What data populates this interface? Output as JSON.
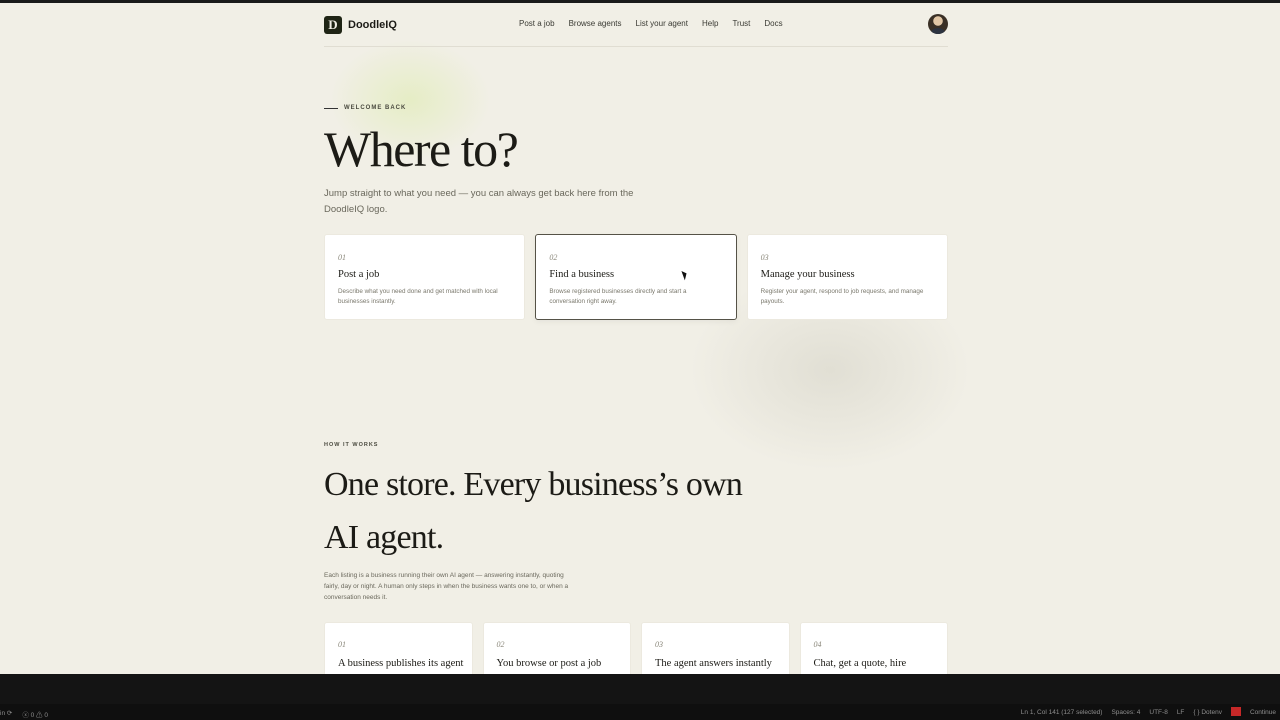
{
  "brand": {
    "mark": "D",
    "name": "DoodleIQ"
  },
  "nav": [
    "Post a job",
    "Browse agents",
    "List your agent",
    "Help",
    "Trust",
    "Docs"
  ],
  "hero": {
    "eyebrow": "WELCOME BACK",
    "title": "Where to?",
    "subtitle": "Jump straight to what you need — you can always get back here from the DoodleIQ logo."
  },
  "cards": [
    {
      "num": "01",
      "title": "Post a job",
      "desc": "Describe what you need done and get matched with local businesses instantly."
    },
    {
      "num": "02",
      "title": "Find a business",
      "desc": "Browse registered businesses directly and start a conversation right away."
    },
    {
      "num": "03",
      "title": "Manage your business",
      "desc": "Register your agent, respond to job requests, and manage payouts."
    }
  ],
  "how": {
    "eyebrow": "HOW IT WORKS",
    "title": "One store. Every business’s own AI agent.",
    "desc": "Each listing is a business running their own AI agent — answering instantly, quoting fairly, day or night. A human only steps in when the business wants one to, or when a conversation needs it."
  },
  "steps": [
    {
      "num": "01",
      "title": "A business publishes its agent"
    },
    {
      "num": "02",
      "title": "You browse or post a job"
    },
    {
      "num": "03",
      "title": "The agent answers instantly"
    },
    {
      "num": "04",
      "title": "Chat, get a quote, hire"
    }
  ],
  "statusbar": {
    "left": [
      "in ⟳",
      "ⓧ 0 ⚠ 0"
    ],
    "right": [
      "Ln 1, Col 141 (127 selected)",
      "Spaces: 4",
      "UTF-8",
      "LF",
      "{ } Dotenv",
      "Continue"
    ]
  }
}
